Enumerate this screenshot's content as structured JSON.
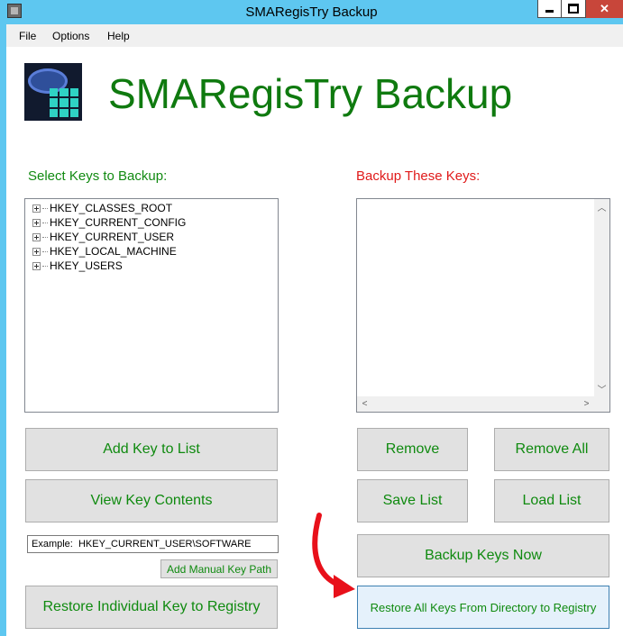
{
  "window": {
    "title": "SMARegisTry Backup",
    "close_label": "✕"
  },
  "menu": {
    "items": [
      "File",
      "Options",
      "Help"
    ]
  },
  "header": {
    "title": "SMARegisTry Backup"
  },
  "left_panel": {
    "label": "Select Keys to Backup:",
    "tree_items": [
      "HKEY_CLASSES_ROOT",
      "HKEY_CURRENT_CONFIG",
      "HKEY_CURRENT_USER",
      "HKEY_LOCAL_MACHINE",
      "HKEY_USERS"
    ]
  },
  "right_panel": {
    "label": "Backup These Keys:",
    "items": []
  },
  "buttons": {
    "add_key": "Add Key to List",
    "view_contents": "View Key Contents",
    "remove": "Remove",
    "remove_all": "Remove All",
    "save_list": "Save List",
    "load_list": "Load List",
    "backup_now": "Backup Keys Now",
    "add_manual": "Add Manual Key Path",
    "restore_individual": "Restore Individual Key to Registry",
    "restore_all": "Restore All Keys From Directory to Registry"
  },
  "manual_path": {
    "value": "Example:  HKEY_CURRENT_USER\\SOFTWARE"
  },
  "colors": {
    "title_bar": "#5ec7f0",
    "title_green": "#0f7a0f",
    "label_red": "#e01a1a",
    "annotation_arrow": "#e8101a",
    "close_button": "#c8463a"
  }
}
